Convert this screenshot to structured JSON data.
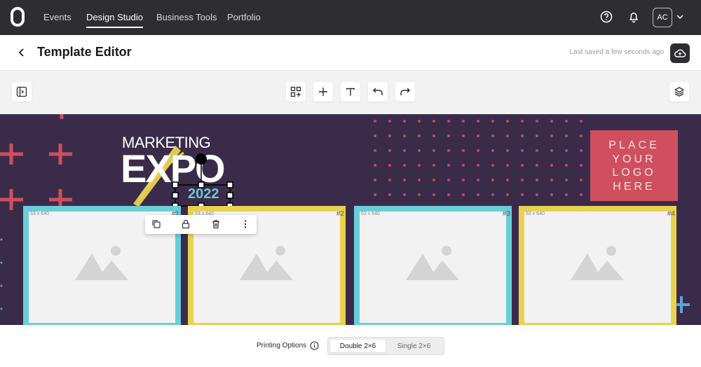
{
  "nav": {
    "items": [
      {
        "label": "Events",
        "active": false
      },
      {
        "label": "Design Studio",
        "active": true
      },
      {
        "label": "Business Tools",
        "active": false
      },
      {
        "label": "Portfolio",
        "active": false
      }
    ],
    "avatar_initials": "AC",
    "icons": [
      "help-icon",
      "bell-icon",
      "chevron-down-icon"
    ]
  },
  "header": {
    "title": "Template Editor",
    "saved_status": "Last saved a few seconds ago"
  },
  "toolbar": {
    "icons": [
      "panel-toggle-icon",
      "add-widget-icon",
      "plus-icon",
      "text-icon",
      "undo-icon",
      "redo-icon",
      "layers-icon"
    ]
  },
  "canvas": {
    "event_title_line1": "MARKETING",
    "event_title_line2": "EXPO",
    "event_year": "2022",
    "logo_placeholder": "PLACE YOUR LOGO HERE",
    "photo_slots": [
      {
        "size": "53 x 640",
        "number": "#1"
      },
      {
        "size": "53 x 640",
        "number": "#2"
      },
      {
        "size": "53 x 640",
        "number": "#3"
      },
      {
        "size": "53 x 640",
        "number": "#4"
      }
    ],
    "context_menu_icons": [
      "duplicate-icon",
      "lock-icon",
      "trash-icon",
      "more-vertical-icon"
    ]
  },
  "footer": {
    "printing_label": "Printing Options",
    "options": [
      {
        "label": "Double 2×6",
        "active": true
      },
      {
        "label": "Single 2×6",
        "active": false
      }
    ]
  },
  "colors": {
    "nav_bg": "#2e2e30",
    "canvas_bg": "#3b2b4a",
    "accent_red": "#cf4f5e",
    "slot_teal": "#69ced8",
    "slot_yellow": "#e8d24f"
  }
}
